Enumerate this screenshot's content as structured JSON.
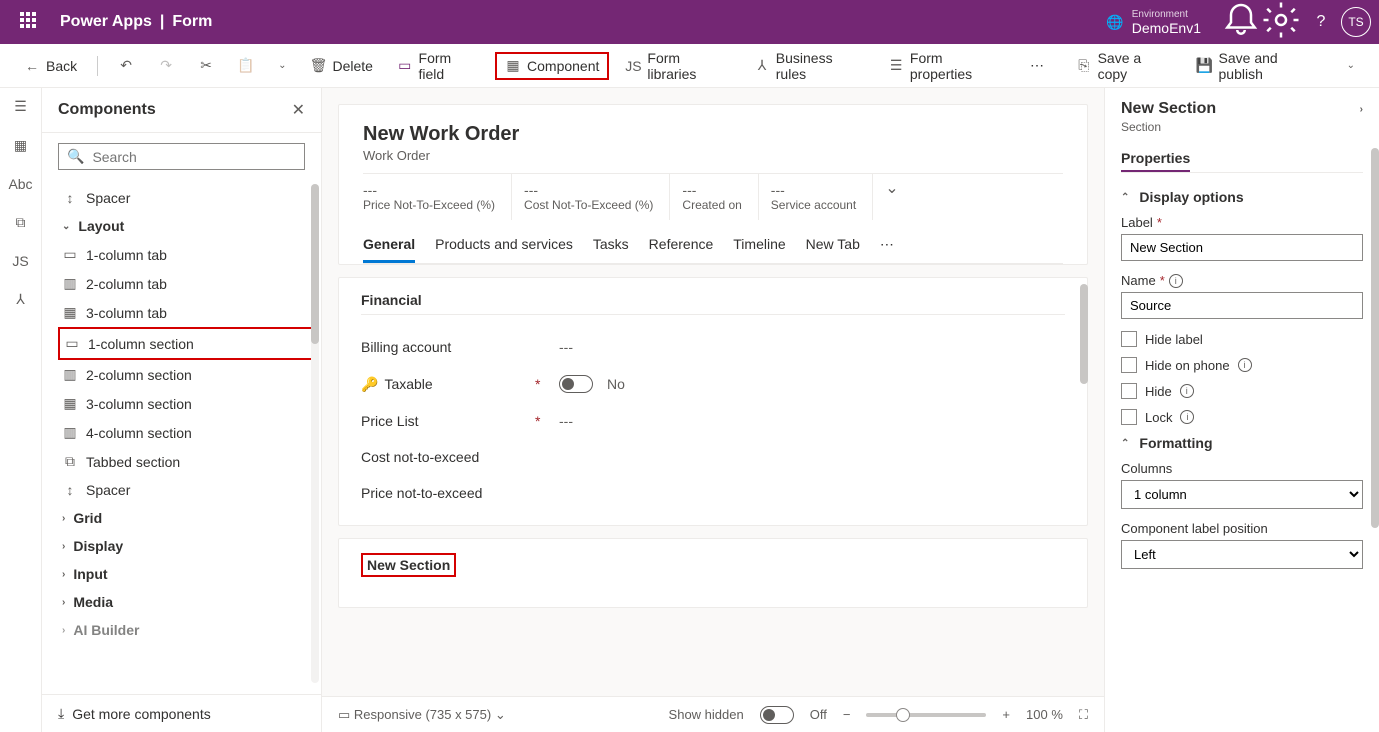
{
  "top": {
    "app": "Power Apps",
    "page": "Form",
    "env_label": "Environment",
    "env_name": "DemoEnv1",
    "avatar": "TS"
  },
  "cmdbar": {
    "back": "Back",
    "delete": "Delete",
    "form_field": "Form field",
    "component": "Component",
    "form_libraries": "Form libraries",
    "business_rules": "Business rules",
    "form_properties": "Form properties",
    "save_copy": "Save a copy",
    "save_publish": "Save and publish"
  },
  "left": {
    "title": "Components",
    "search_placeholder": "Search",
    "items": {
      "spacer1": "Spacer",
      "layout": "Layout",
      "c1tab": "1-column tab",
      "c2tab": "2-column tab",
      "c3tab": "3-column tab",
      "c1sec": "1-column section",
      "c2sec": "2-column section",
      "c3sec": "3-column section",
      "c4sec": "4-column section",
      "tabbed": "Tabbed section",
      "spacer2": "Spacer",
      "grid": "Grid",
      "display": "Display",
      "input": "Input",
      "media": "Media",
      "ai": "AI Builder"
    },
    "footer": "Get more components"
  },
  "form": {
    "title": "New Work Order",
    "entity": "Work Order",
    "kpis": [
      {
        "value": "---",
        "label": "Price Not-To-Exceed (%)"
      },
      {
        "value": "---",
        "label": "Cost Not-To-Exceed (%)"
      },
      {
        "value": "---",
        "label": "Created on"
      },
      {
        "value": "---",
        "label": "Service account"
      }
    ],
    "tabs": [
      "General",
      "Products and services",
      "Tasks",
      "Reference",
      "Timeline",
      "New Tab"
    ],
    "section1": {
      "title": "Financial",
      "rows": {
        "billing": "Billing account",
        "taxable": "Taxable",
        "taxable_val": "No",
        "pricelist": "Price List",
        "cost": "Cost not-to-exceed",
        "price": "Price not-to-exceed"
      }
    },
    "section2": {
      "title": "New Section"
    }
  },
  "status": {
    "responsive": "Responsive (735 x 575)",
    "show_hidden": "Show hidden",
    "off": "Off",
    "zoom": "100 %"
  },
  "right": {
    "title": "New Section",
    "sub": "Section",
    "tab": "Properties",
    "group1": "Display options",
    "label_lbl": "Label",
    "label_val": "New Section",
    "name_lbl": "Name",
    "name_val": "Source",
    "hide_label": "Hide label",
    "hide_phone": "Hide on phone",
    "hide": "Hide",
    "lock": "Lock",
    "group2": "Formatting",
    "columns_lbl": "Columns",
    "columns_val": "1 column",
    "clp_lbl": "Component label position",
    "clp_val": "Left"
  }
}
